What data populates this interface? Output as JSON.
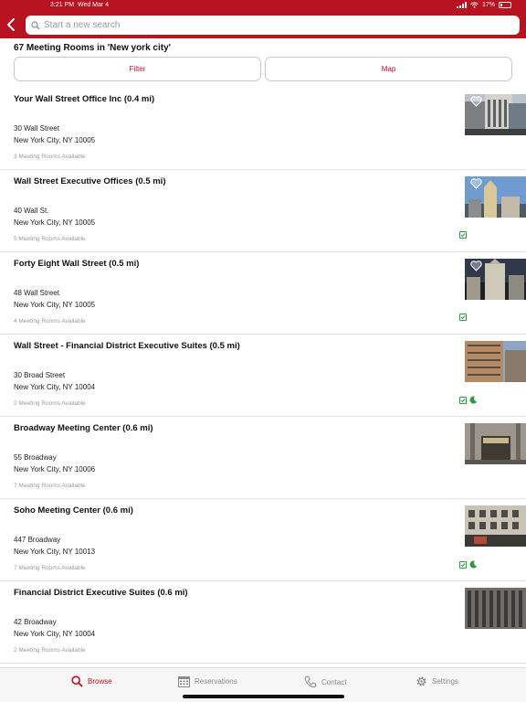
{
  "status_bar": {
    "time": "3:21 PM",
    "date": "Wed Mar 4",
    "battery": "17%"
  },
  "search": {
    "placeholder": "Start a new search"
  },
  "results": {
    "count_text": "67 Meeting Rooms in 'New york city'"
  },
  "buttons": {
    "filter": "Filter",
    "map": "Map"
  },
  "listings": [
    {
      "name": "Your Wall Street Office Inc (0.4 mi)",
      "address1": "30 Wall Street",
      "address2": "New York City, NY 10005",
      "availability": "3 Meeting Rooms Available",
      "favorite": true,
      "check": false,
      "moon": false
    },
    {
      "name": "Wall Street Executive Offices (0.5 mi)",
      "address1": "40 Wall St.",
      "address2": "New York City, NY 10005",
      "availability": "5 Meeting Rooms Available",
      "favorite": true,
      "check": true,
      "moon": false
    },
    {
      "name": "Forty Eight Wall Street (0.5 mi)",
      "address1": "48 Wall Street",
      "address2": "New York City, NY 10005",
      "availability": "4 Meeting Rooms Available",
      "favorite": true,
      "check": true,
      "moon": false
    },
    {
      "name": "Wall Street - Financial District Executive Suites (0.5 mi)",
      "address1": "30 Broad Street",
      "address2": "New York City, NY 10004",
      "availability": "2 Meeting Rooms Available",
      "favorite": false,
      "check": true,
      "moon": true
    },
    {
      "name": "Broadway Meeting Center (0.6 mi)",
      "address1": "55 Broadway",
      "address2": "New York City, NY 10006",
      "availability": "7 Meeting Rooms Available",
      "favorite": false,
      "check": false,
      "moon": false
    },
    {
      "name": "Soho Meeting Center (0.6 mi)",
      "address1": "447 Broadway",
      "address2": "New York City, NY 10013",
      "availability": "7 Meeting Rooms Available",
      "favorite": false,
      "check": true,
      "moon": true
    },
    {
      "name": "Financial District Executive Suites (0.6 mi)",
      "address1": "42 Broadway",
      "address2": "New York City, NY 10004",
      "availability": "2 Meeting Rooms Available",
      "favorite": false,
      "check": false,
      "moon": false
    }
  ],
  "tabs": {
    "browse": "Browse",
    "reservations": "Reservations",
    "contact": "Contact",
    "settings": "Settings"
  },
  "colors": {
    "brand_red": "#b8111f",
    "accent_red": "#c0101f",
    "check_green": "#2c9b3c"
  }
}
